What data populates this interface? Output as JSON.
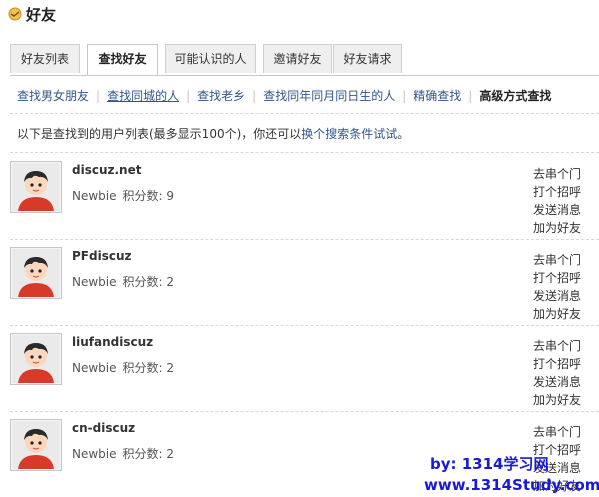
{
  "page": {
    "title": "好友",
    "icon": "handshake-icon"
  },
  "tabs": [
    {
      "label": "好友列表",
      "active": false
    },
    {
      "label": "查找好友",
      "active": true
    },
    {
      "label": "可能认识的人",
      "active": false
    },
    {
      "label": "邀请好友",
      "active": false
    },
    {
      "label": "好友请求",
      "active": false
    }
  ],
  "subnav": [
    {
      "label": "查找男女朋友"
    },
    {
      "label": "查找同城的人"
    },
    {
      "label": "查找老乡"
    },
    {
      "label": "查找同年同月同日生的人"
    },
    {
      "label": "精确查找"
    },
    {
      "label": "高级方式查找",
      "current": true
    }
  ],
  "result_info": {
    "prefix": "以下是查找到的用户列表(最多显示100个)，你还可以",
    "link": "换个搜索条件试试",
    "suffix": "。"
  },
  "actions": {
    "visit": "去串个门",
    "greet": "打个招呼",
    "message": "发送消息",
    "add_friend": "加为好友"
  },
  "users": [
    {
      "name": "discuz.net",
      "level": "Newbie",
      "points_label": "积分数:",
      "points": "9"
    },
    {
      "name": "PFdiscuz",
      "level": "Newbie",
      "points_label": "积分数:",
      "points": "2"
    },
    {
      "name": "liufandiscuz",
      "level": "Newbie",
      "points_label": "积分数:",
      "points": "2"
    },
    {
      "name": "cn-discuz",
      "level": "Newbie",
      "points_label": "积分数:",
      "points": "2"
    }
  ],
  "watermark": {
    "line1": "by: 1314学习网",
    "line2": "www.1314Study.com"
  },
  "colors": {
    "link": "#335588",
    "watermark": "#1a1ad6"
  }
}
